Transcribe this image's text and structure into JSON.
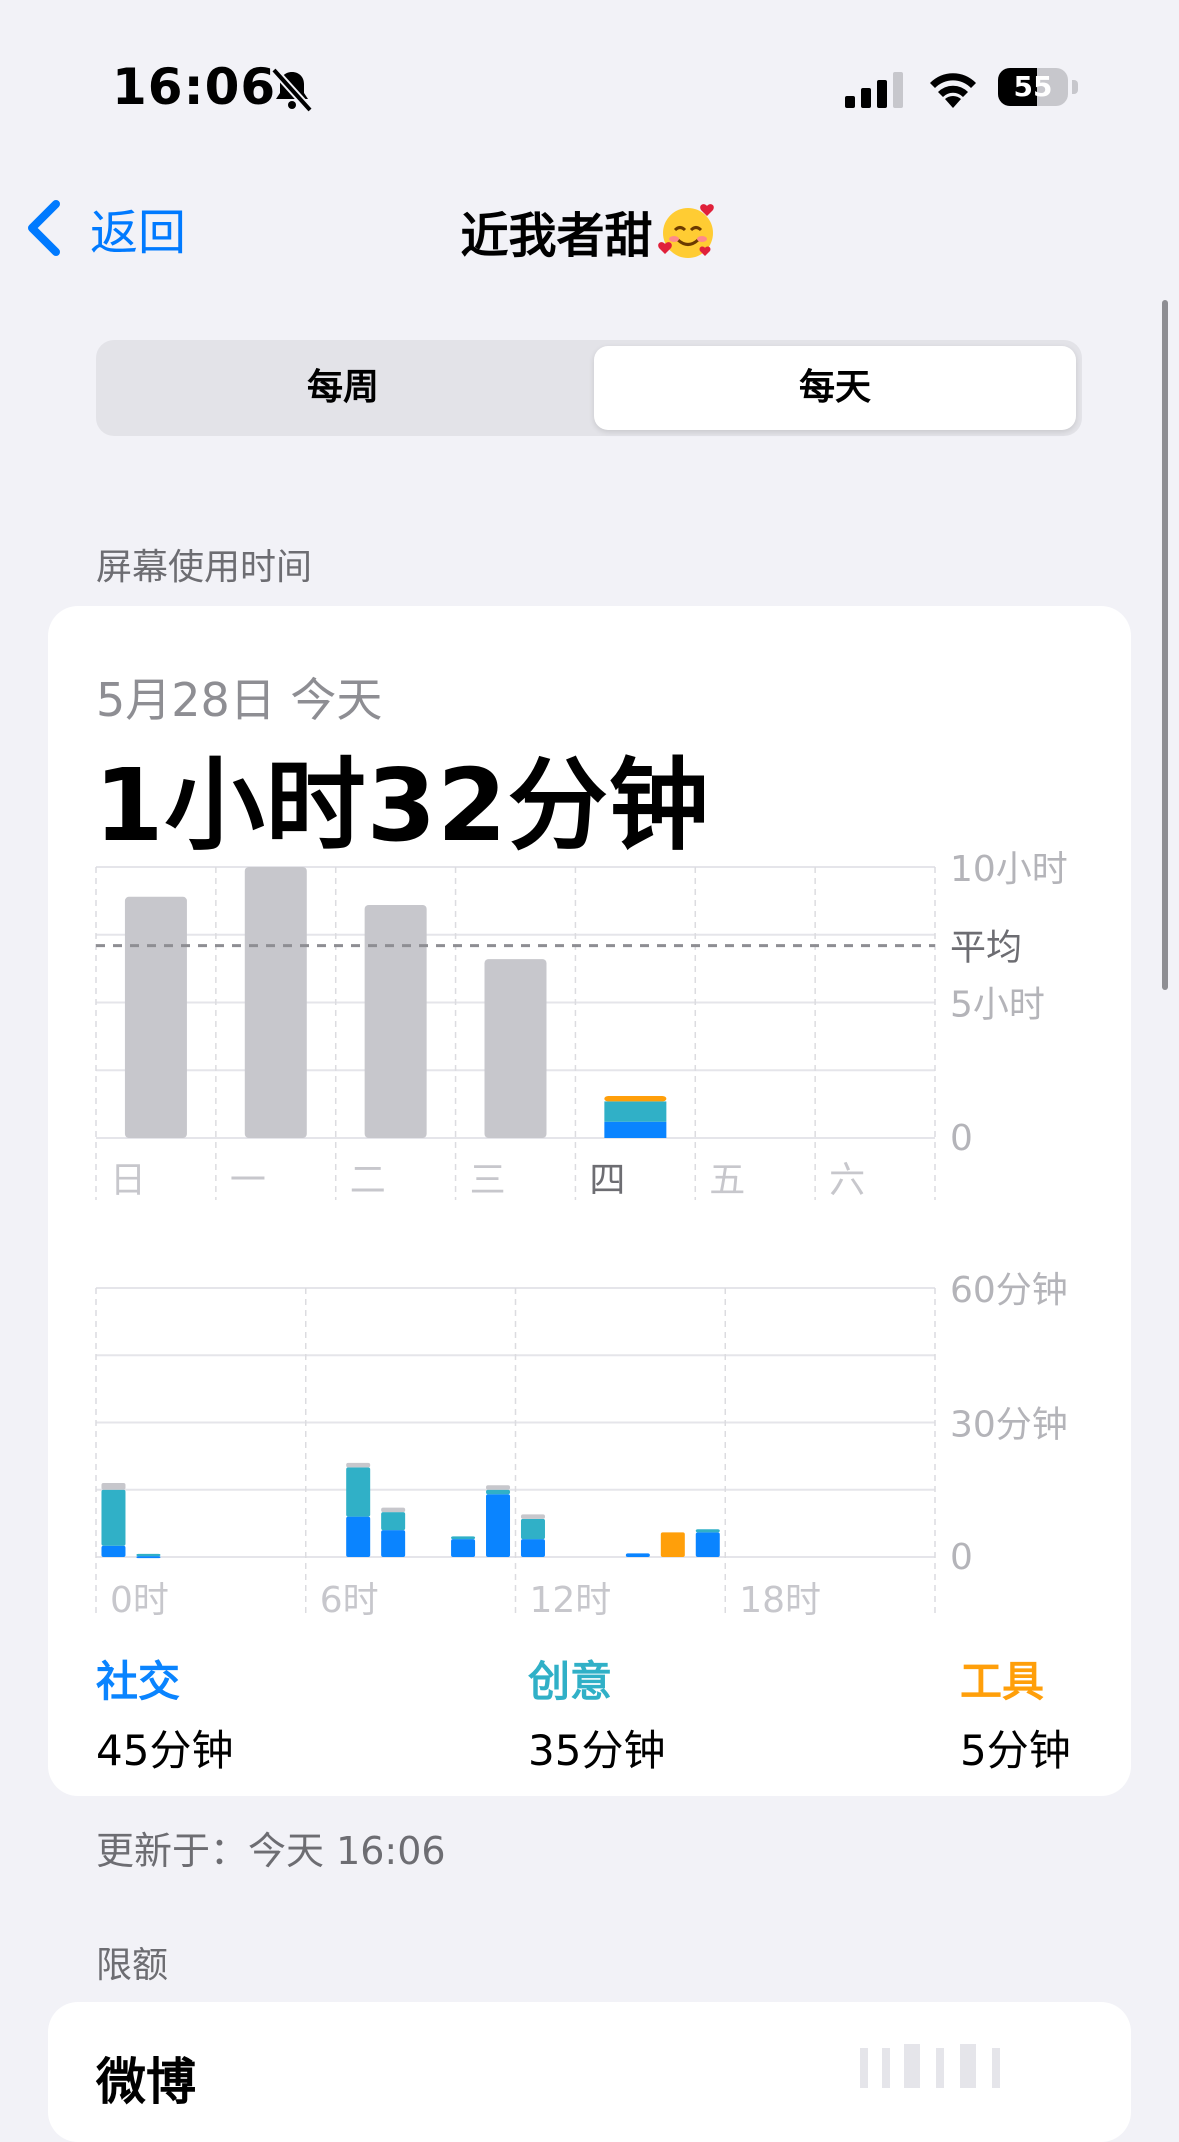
{
  "status_bar": {
    "time": "16:06",
    "battery": "55"
  },
  "nav": {
    "back_label": "返回",
    "title": "近我者甜"
  },
  "segments": {
    "weekly": "每周",
    "daily": "每天",
    "selected": "daily"
  },
  "screen_time": {
    "section_label": "屏幕使用时间",
    "date": "5月28日 今天",
    "total": "1小时32分钟",
    "updated": "更新于：今天 16:06"
  },
  "colors": {
    "social": "#0a84ff",
    "creative": "#30b0c7",
    "tools": "#ff9f0a",
    "other": "#c7c7cc"
  },
  "chart_data": [
    {
      "type": "bar",
      "categories": [
        "日",
        "一",
        "二",
        "三",
        "四",
        "五",
        "六"
      ],
      "highlight_category": "四",
      "average_label": "平均",
      "average_hours": 7.1,
      "y_tick_labels": [
        "10小时",
        "5小时",
        "0"
      ],
      "ylim": [
        0,
        10
      ],
      "series": [
        {
          "name": "社交",
          "values": [
            0,
            0,
            0,
            0,
            0.6,
            0,
            0
          ]
        },
        {
          "name": "创意",
          "values": [
            0,
            0,
            0,
            0,
            0.75,
            0,
            0
          ]
        },
        {
          "values": [
            8.9,
            10.0,
            8.6,
            6.6,
            0.2,
            0,
            0
          ]
        }
      ]
    },
    {
      "type": "bar",
      "x_tick_labels": [
        "0时",
        "6时",
        "12时",
        "18时"
      ],
      "y_tick_labels": [
        "60分钟",
        "30分钟",
        "0"
      ],
      "ylim": [
        0,
        60
      ],
      "hours": [
        0,
        1,
        7,
        8,
        10,
        11,
        12,
        15,
        16,
        17
      ],
      "series": [
        {
          "name": "社交",
          "values": [
            2.5,
            0.2,
            9,
            6,
            4,
            14,
            4,
            0.8,
            0,
            5.5
          ]
        },
        {
          "name": "创意",
          "values": [
            12.5,
            0.5,
            11,
            4,
            0.6,
            1,
            4.5,
            0,
            0,
            0.7
          ]
        },
        {
          "name": "工具",
          "values": [
            0,
            0,
            0,
            0,
            0,
            0,
            0,
            0,
            5.5,
            0
          ]
        },
        {
          "values": [
            1.5,
            0,
            1,
            1,
            0,
            1,
            1,
            0,
            0,
            0
          ]
        }
      ]
    }
  ],
  "categories": [
    {
      "name": "社交",
      "value": "45分钟",
      "color": "#0a84ff"
    },
    {
      "name": "创意",
      "value": "35分钟",
      "color": "#30b0c7"
    },
    {
      "name": "工具",
      "value": "5分钟",
      "color": "#ff9f0a"
    }
  ],
  "limits": {
    "section_label": "限额",
    "first_app": "微博"
  }
}
